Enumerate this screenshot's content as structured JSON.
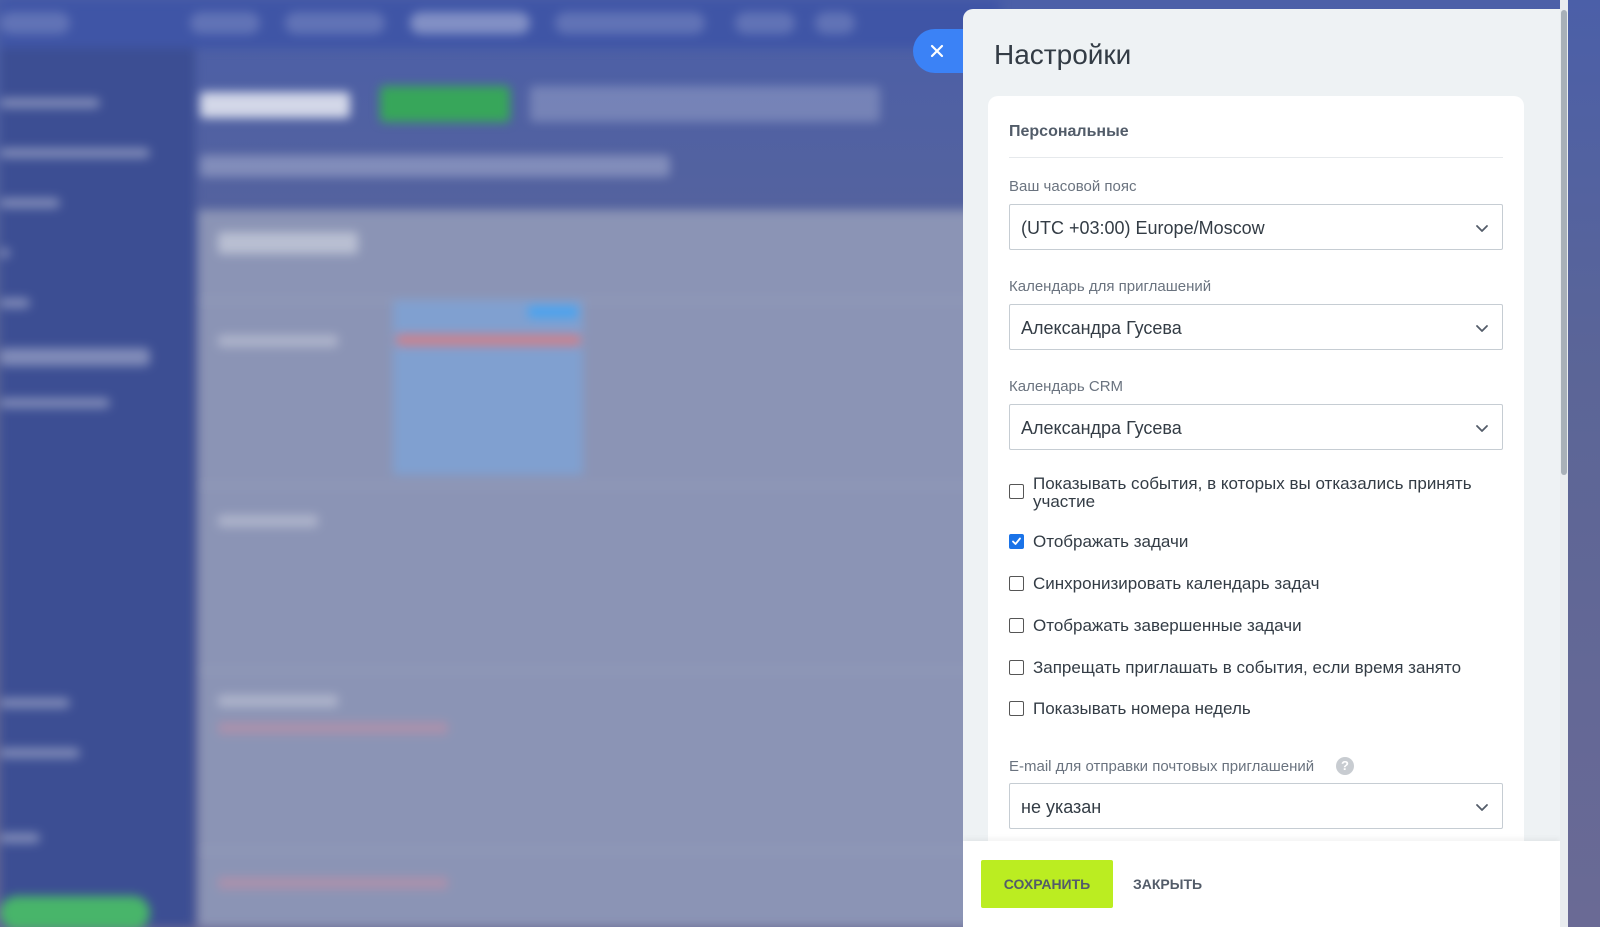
{
  "panel": {
    "title": "Настройки"
  },
  "personal": {
    "section_title": "Персональные",
    "timezone": {
      "label": "Ваш часовой пояс",
      "value": "(UTC +03:00) Europe/Moscow"
    },
    "invite_calendar": {
      "label": "Календарь для приглашений",
      "value": "Александра Гусева"
    },
    "crm_calendar": {
      "label": "Календарь CRM",
      "value": "Александра Гусева"
    },
    "options": [
      {
        "label": "Показывать события, в которых вы отказались принять участие",
        "checked": false
      },
      {
        "label": "Отображать задачи",
        "checked": true
      },
      {
        "label": "Синхронизировать календарь задач",
        "checked": false
      },
      {
        "label": "Отображать завершенные задачи",
        "checked": false
      },
      {
        "label": "Запрещать приглашать в события, если время занято",
        "checked": false
      },
      {
        "label": "Показывать номера недель",
        "checked": false
      }
    ],
    "email": {
      "label": "E-mail для отправки почтовых приглашений",
      "help": "?",
      "value": "не указан"
    }
  },
  "footer": {
    "save_label": "СОХРАНИТЬ",
    "close_label": "ЗАКРЫТЬ"
  },
  "icons": {
    "close_tab": "close-icon",
    "select_arrow": "chevron-down-icon",
    "help": "question-icon"
  },
  "colors": {
    "accent_blue": "#3b82f6",
    "save_button": "#bbed21",
    "checkbox_checked": "#1a73e8"
  }
}
